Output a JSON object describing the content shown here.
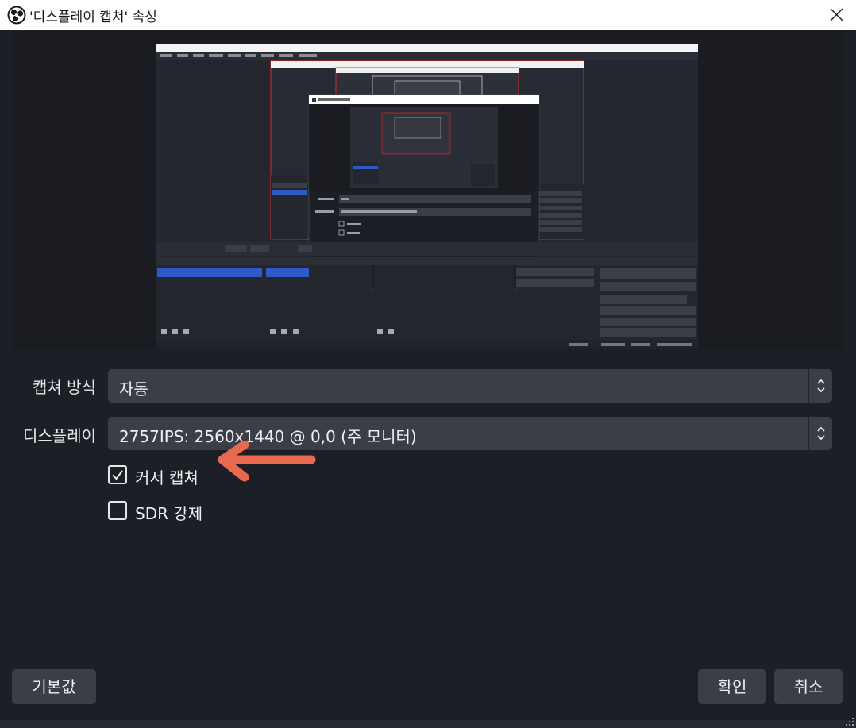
{
  "window": {
    "title": "'디스플레이 캡쳐' 속성",
    "app_icon": "obs-logo-icon",
    "close_icon": "close-icon"
  },
  "form": {
    "capture_method": {
      "label": "캡쳐 방식",
      "value": "자동"
    },
    "display": {
      "label": "디스플레이",
      "value": "2757IPS: 2560x1440 @ 0,0 (주 모니터)"
    },
    "capture_cursor": {
      "label": "커서 캡쳐",
      "checked": true
    },
    "force_sdr": {
      "label": "SDR 강제",
      "checked": false
    }
  },
  "annotation": {
    "arrow_color": "#e8694e"
  },
  "buttons": {
    "defaults": "기본값",
    "ok": "확인",
    "cancel": "취소"
  },
  "colors": {
    "background": "#1d1f26",
    "control": "#3b3e47",
    "accent_blue": "#2f59c9",
    "selection_red": "#e0242c"
  }
}
